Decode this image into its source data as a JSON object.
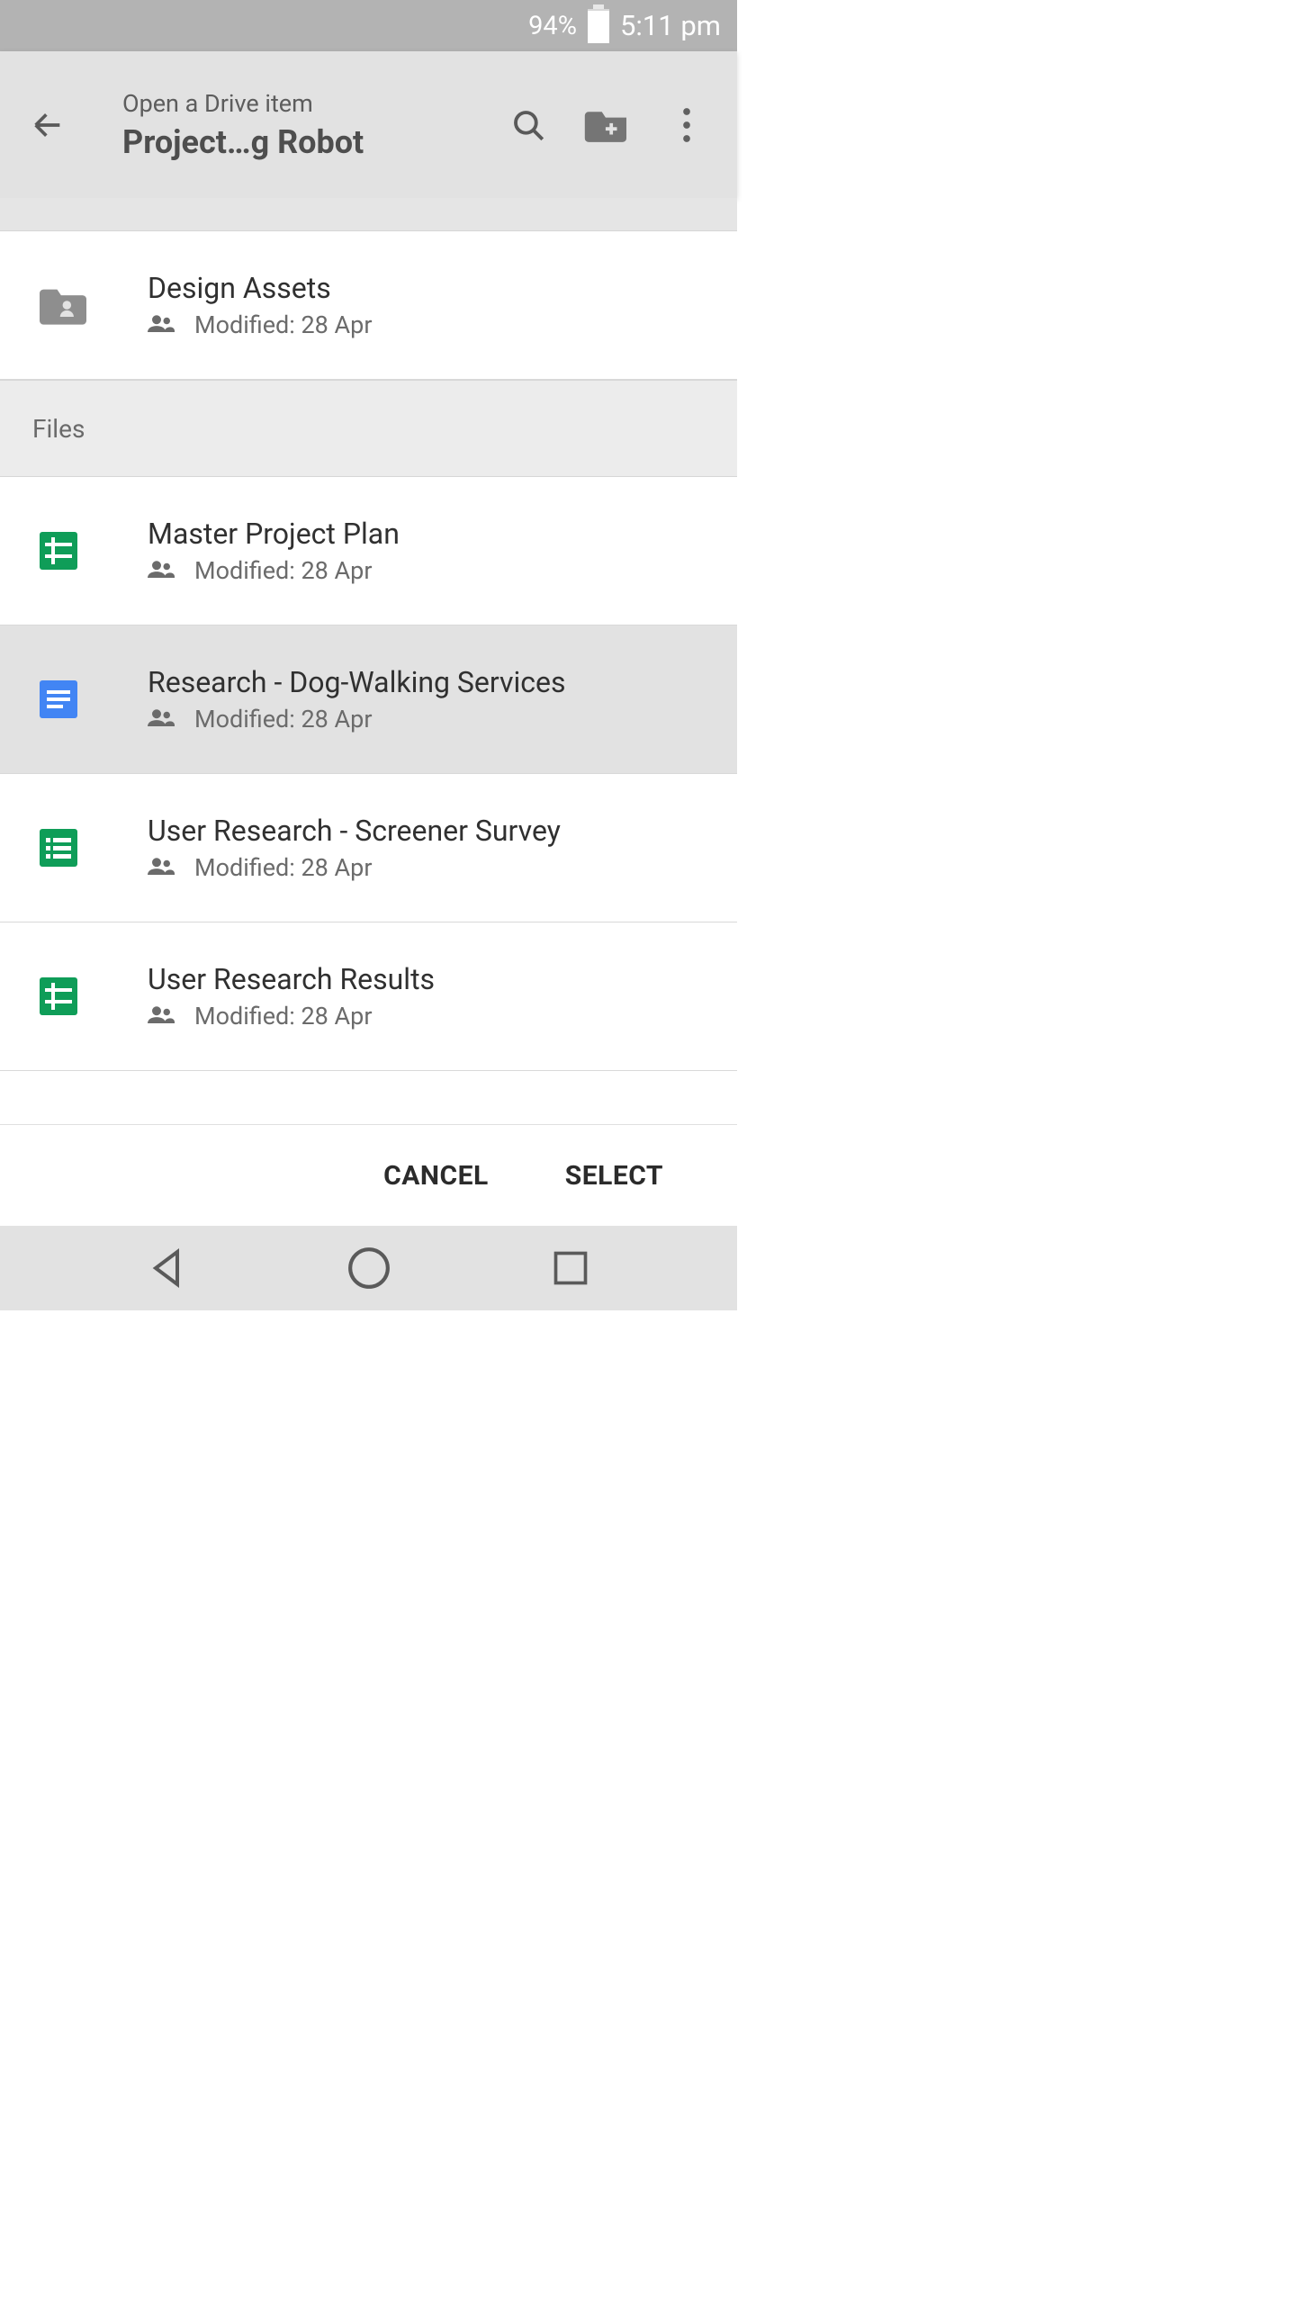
{
  "status": {
    "battery_pct": "94%",
    "time": "5:11 pm"
  },
  "header": {
    "subtitle": "Open a Drive item",
    "title": "Project…g Robot"
  },
  "folders": [
    {
      "name": "Design Assets",
      "modified": "Modified: 28 Apr",
      "shared": true
    }
  ],
  "section_label": "Files",
  "files": [
    {
      "name": "Master Project Plan",
      "modified": "Modified: 28 Apr",
      "type": "sheets",
      "selected": false
    },
    {
      "name": "Research - Dog-Walking Services",
      "modified": "Modified: 28 Apr",
      "type": "docs",
      "selected": true
    },
    {
      "name": "User Research - Screener Survey",
      "modified": "Modified: 28 Apr",
      "type": "forms",
      "selected": false
    },
    {
      "name": "User Research Results",
      "modified": "Modified: 28 Apr",
      "type": "sheets",
      "selected": false
    }
  ],
  "actions": {
    "cancel": "CANCEL",
    "select": "SELECT"
  }
}
